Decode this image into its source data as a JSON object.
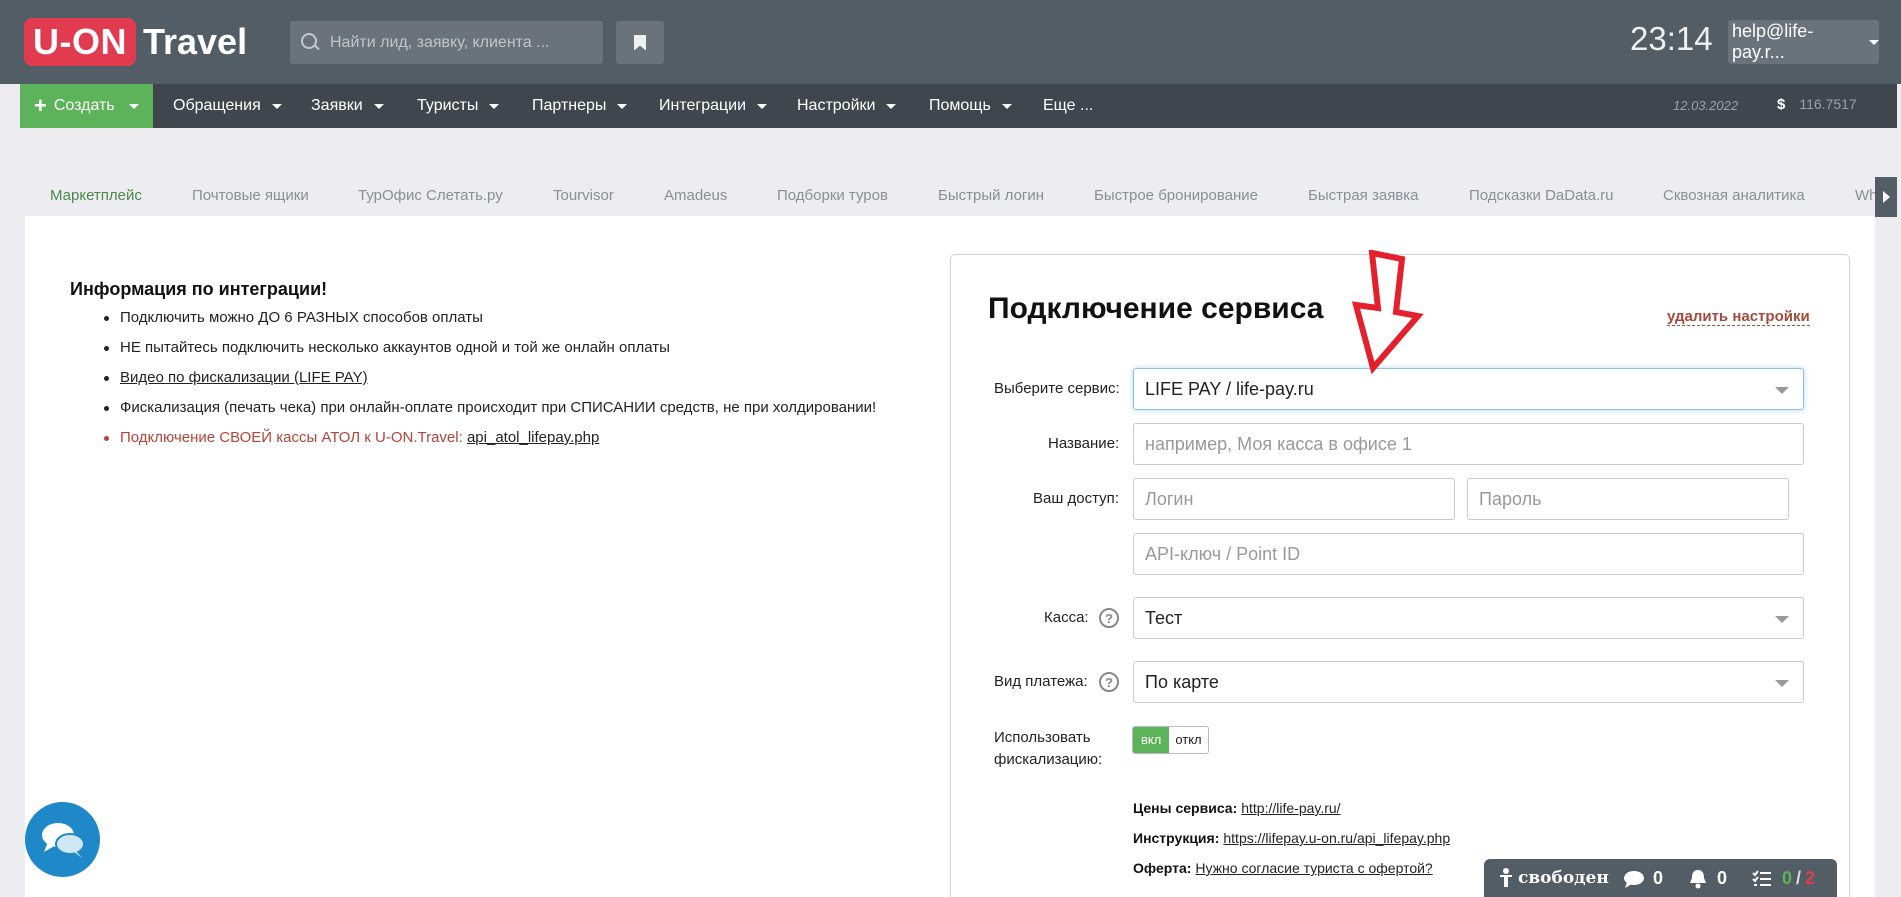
{
  "header": {
    "logo_brand": "U-ON",
    "logo_product": "Travel",
    "search_placeholder": "Найти лид, заявку, клиента ...",
    "clock": "23:14",
    "user_email": "help@life-pay.r..."
  },
  "nav": {
    "create_label": "Создать",
    "items": [
      "Обращения",
      "Заявки",
      "Туристы",
      "Партнеры",
      "Интеграции",
      "Настройки",
      "Помощь",
      "Еще ..."
    ],
    "date": "12.03.2022",
    "currency_symbol": "$",
    "rate": "116.7517"
  },
  "tabs": [
    "Маркетплейс",
    "Почтовые ящики",
    "ТурОфис Слетать.ру",
    "Tourvisor",
    "Amadeus",
    "Подборки туров",
    "Быстрый логин",
    "Быстрое бронирование",
    "Быстрая заявка",
    "Подсказки DaData.ru",
    "Сквозная аналитика",
    "Wh"
  ],
  "info": {
    "title": "Информация по интеграции!",
    "items": [
      "Подключить можно ДО 6 РАЗНЫХ способов оплаты",
      "НЕ пытайтесь подключить несколько аккаунтов одной и той же онлайн оплаты",
      "Видео по фискализации (LIFE PAY)",
      "Фискализация (печать чека) при онлайн-оплате происходит при СПИСАНИИ средств, не при холдировании!"
    ],
    "atol_text": "Подключение СВОЕЙ кассы АТОЛ к U-ON.Travel:",
    "atol_link": "api_atol_lifepay.php"
  },
  "form": {
    "title": "Подключение сервиса",
    "delete_link": "удалить настройки",
    "service_label": "Выберите сервис:",
    "service_value": "LIFE PAY / life-pay.ru",
    "name_label": "Название:",
    "name_placeholder": "например, Моя касса в офисе 1",
    "access_label": "Ваш доступ:",
    "login_placeholder": "Логин",
    "password_placeholder": "Пароль",
    "api_placeholder": "API-ключ / Point ID",
    "kassa_label": "Касса:",
    "kassa_value": "Тест",
    "payment_label": "Вид платежа:",
    "payment_value": "По карте",
    "fiscal_label_1": "Использовать",
    "fiscal_label_2": "фискализацию:",
    "toggle_on": "вкл",
    "toggle_off": "откл",
    "help_glyph": "?",
    "prices_label": "Цены сервиса:",
    "prices_link": "http://life-pay.ru/",
    "instruction_label": "Инструкция:",
    "instruction_link": "https://lifepay.u-on.ru/api_lifepay.php",
    "offer_label": "Оферта:",
    "offer_link": "Нужно согласие туриста с офертой?"
  },
  "statusbar": {
    "status": "свободен",
    "messages": "0",
    "notifications": "0",
    "tasks_done": "0",
    "tasks_sep": "/",
    "tasks_total": "2"
  },
  "colors": {
    "accent_green": "#5cb359",
    "brand_red": "#e23a4f",
    "topbar": "#535d65",
    "navbar": "#3f464d"
  }
}
